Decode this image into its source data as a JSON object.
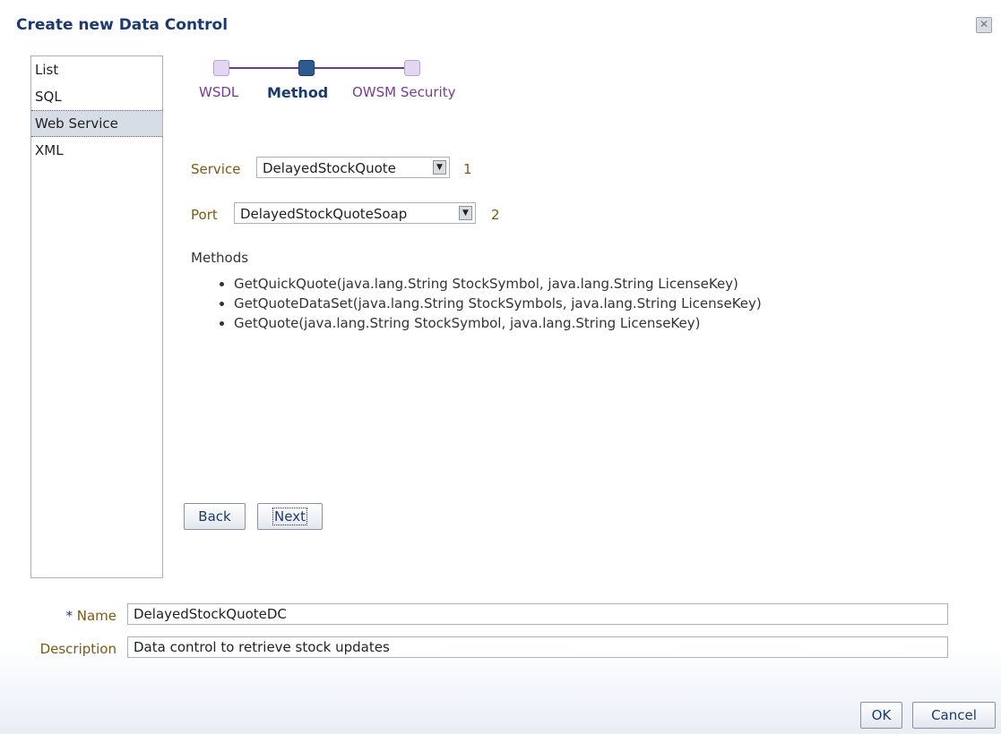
{
  "dialog": {
    "title": "Create new Data Control",
    "close_icon": "close-icon"
  },
  "type_list": {
    "items": [
      {
        "label": "List"
      },
      {
        "label": "SQL"
      },
      {
        "label": "Web Service",
        "selected": true
      },
      {
        "label": "XML"
      }
    ]
  },
  "train": {
    "steps": [
      {
        "label": "WSDL"
      },
      {
        "label": "Method",
        "current": true
      },
      {
        "label": "OWSM Security"
      }
    ]
  },
  "service": {
    "label": "Service",
    "value": "DelayedStockQuote",
    "step": "1"
  },
  "port": {
    "label": "Port",
    "value": "DelayedStockQuoteSoap",
    "step": "2"
  },
  "methods": {
    "heading": "Methods",
    "items": [
      "GetQuickQuote(java.lang.String StockSymbol, java.lang.String LicenseKey)",
      "GetQuoteDataSet(java.lang.String StockSymbols, java.lang.String LicenseKey)",
      "GetQuote(java.lang.String StockSymbol, java.lang.String LicenseKey)"
    ]
  },
  "nav": {
    "back": "Back",
    "next": "Next"
  },
  "form": {
    "name_required": "*",
    "name_label": "Name",
    "name_value": "DelayedStockQuoteDC",
    "description_label": "Description",
    "description_value": "Data control to retrieve stock updates"
  },
  "footer": {
    "ok": "OK",
    "cancel": "Cancel"
  }
}
